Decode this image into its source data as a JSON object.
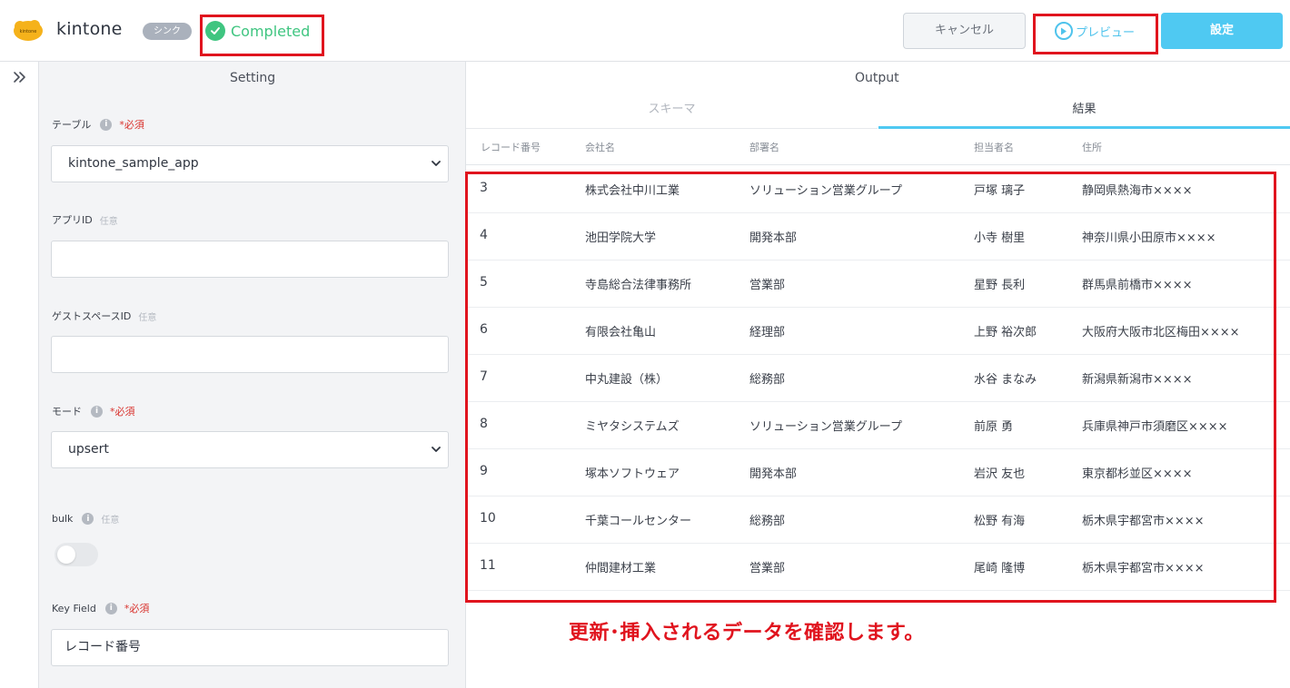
{
  "header": {
    "app_title": "kintone",
    "logo_text": "kintone",
    "sync_badge": "シンク",
    "status": "Completed",
    "cancel_label": "キャンセル",
    "preview_label": "プレビュー",
    "settings_label": "設定"
  },
  "setting": {
    "title": "Setting",
    "table": {
      "label": "テーブル",
      "required": "*必須",
      "value": "kintone_sample_app"
    },
    "app_id": {
      "label": "アプリID",
      "optional": "任意",
      "value": ""
    },
    "guest_space_id": {
      "label": "ゲストスペースID",
      "optional": "任意",
      "value": ""
    },
    "mode": {
      "label": "モード",
      "required": "*必須",
      "value": "upsert"
    },
    "bulk": {
      "label": "bulk",
      "optional": "任意",
      "enabled": false
    },
    "key_field": {
      "label": "Key Field",
      "required": "*必須",
      "value": "レコード番号"
    }
  },
  "output": {
    "title": "Output",
    "tabs": [
      {
        "label": "スキーマ",
        "active": false
      },
      {
        "label": "結果",
        "active": true
      }
    ],
    "columns": [
      "レコード番号",
      "会社名",
      "部署名",
      "担当者名",
      "住所"
    ],
    "rows": [
      [
        "3",
        "株式会社中川工業",
        "ソリューション営業グループ",
        "戸塚 璃子",
        "静岡県熱海市××××"
      ],
      [
        "4",
        "池田学院大学",
        "開発本部",
        "小寺 樹里",
        "神奈川県小田原市××××"
      ],
      [
        "5",
        "寺島総合法律事務所",
        "営業部",
        "星野 長利",
        "群馬県前橋市××××"
      ],
      [
        "6",
        "有限会社亀山",
        "経理部",
        "上野 裕次郎",
        "大阪府大阪市北区梅田××××"
      ],
      [
        "7",
        "中丸建設（株）",
        "総務部",
        "水谷 まなみ",
        "新潟県新潟市××××"
      ],
      [
        "8",
        "ミヤタシステムズ",
        "ソリューション営業グループ",
        "前原 勇",
        "兵庫県神戸市須磨区××××"
      ],
      [
        "9",
        "塚本ソフトウェア",
        "開発本部",
        "岩沢 友也",
        "東京都杉並区××××"
      ],
      [
        "10",
        "千葉コールセンター",
        "総務部",
        "松野 有海",
        "栃木県宇都宮市××××"
      ],
      [
        "11",
        "仲間建材工業",
        "営業部",
        "尾崎 隆博",
        "栃木県宇都宮市××××"
      ]
    ]
  },
  "annotation": "更新･挿入されるデータを確認します。",
  "colors": {
    "accent": "#4fc9f2",
    "success": "#3fc580",
    "highlight": "#e0141e",
    "required": "#d9322d"
  }
}
